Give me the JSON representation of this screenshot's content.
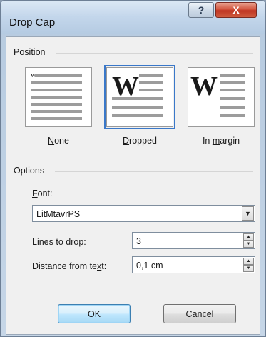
{
  "dialog": {
    "title": "Drop Cap",
    "help_glyph": "?",
    "close_glyph": "X"
  },
  "position": {
    "group_label": "Position",
    "options": [
      {
        "label": "None",
        "mnemonic": "N",
        "rest": "one",
        "selected": false,
        "icon": "no-drop-cap-icon"
      },
      {
        "label": "Dropped",
        "mnemonic": "D",
        "rest": "ropped",
        "selected": true,
        "icon": "dropped-cap-icon"
      },
      {
        "label": "In margin",
        "prefix": "In ",
        "mnemonic": "m",
        "rest": "argin",
        "selected": false,
        "icon": "margin-cap-icon"
      }
    ],
    "preview_letter": "W"
  },
  "options": {
    "group_label": "Options",
    "font": {
      "label_mnemonic": "F",
      "label_rest": "ont:",
      "value": "LitMtavrPS"
    },
    "lines_to_drop": {
      "label_mnemonic": "L",
      "label_rest": "ines to drop:",
      "value": "3"
    },
    "distance": {
      "label_prefix": "Distance from te",
      "label_mnemonic": "x",
      "label_rest": "t:",
      "value": "0,1 cm"
    }
  },
  "buttons": {
    "ok": "OK",
    "cancel": "Cancel"
  }
}
